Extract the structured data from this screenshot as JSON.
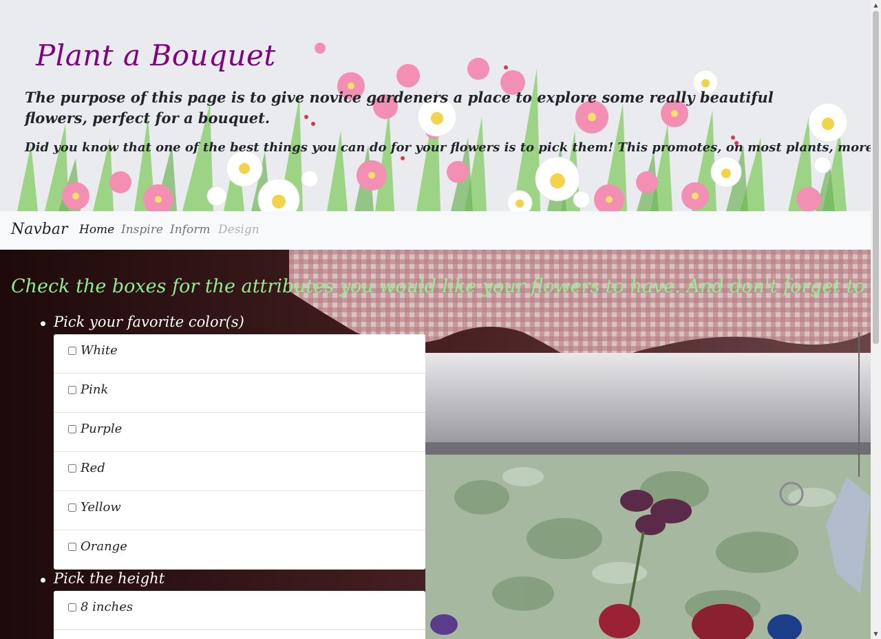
{
  "header": {
    "title": "Plant a Bouquet",
    "intro": "The purpose of this page is to give novice gardeners a place to explore some really beautiful flowers, perfect for a bouquet.",
    "tip": "Did you know that one of the best things you can do for your flowers is to pick them! This promotes, on most plants, more blooms!"
  },
  "navbar": {
    "brand": "Navbar",
    "links": [
      {
        "label": "Home",
        "state": "active"
      },
      {
        "label": "Inspire",
        "state": "normal"
      },
      {
        "label": "Inform",
        "state": "normal"
      },
      {
        "label": "Design",
        "state": "disabled"
      }
    ]
  },
  "main": {
    "heading": "Check the boxes for the attributes you would like your flowers to have. And don't forget to have fun!",
    "groups": [
      {
        "title": "Pick your favorite color(s)",
        "options": [
          "White",
          "Pink",
          "Purple",
          "Red",
          "Yellow",
          "Orange"
        ]
      },
      {
        "title": "Pick the height",
        "options": [
          "8 inches"
        ]
      }
    ]
  },
  "colors": {
    "title": "#800080",
    "heading": "#90ee90",
    "navbar_bg": "#f8f9fa",
    "header_bg": "#e9ebee"
  },
  "icons": {
    "scroll_up": "scroll-up-arrow-icon",
    "scroll_down": "scroll-down-arrow-icon"
  }
}
